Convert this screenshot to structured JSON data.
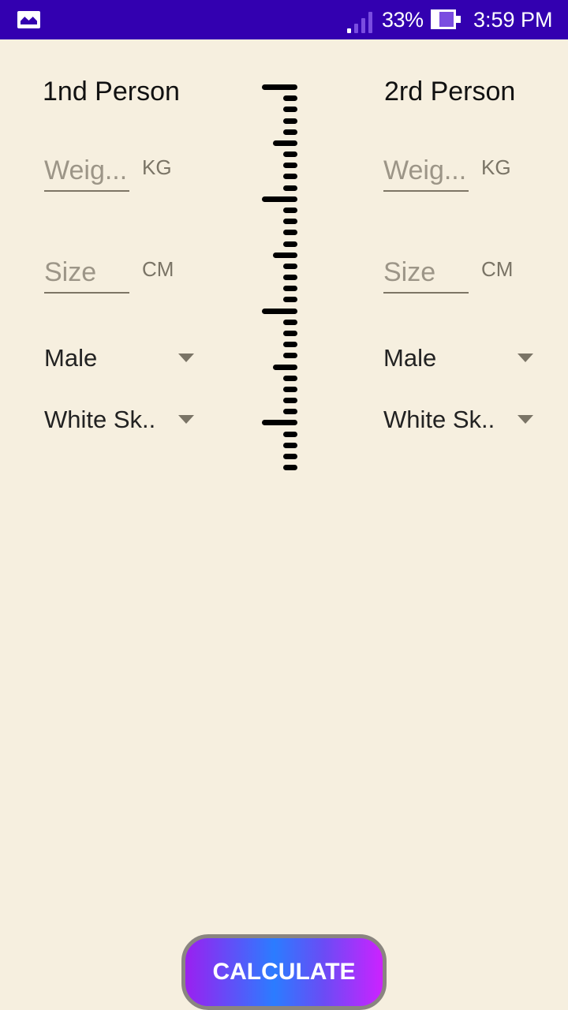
{
  "status_bar": {
    "left_icon": "gallery-icon",
    "signal_icon": "signal-icon",
    "battery_percent": "33%",
    "battery_icon": "battery-icon",
    "time": "3:59 PM",
    "background_color": "#3300b0"
  },
  "person1": {
    "title": "1nd Person",
    "weight": {
      "placeholder": "Weig...",
      "value": "",
      "unit": "KG"
    },
    "size": {
      "placeholder": "Size",
      "value": "",
      "unit": "CM"
    },
    "gender": {
      "selected": "Male"
    },
    "skin": {
      "selected": "White Sk.."
    }
  },
  "person2": {
    "title": "2rd Person",
    "weight": {
      "placeholder": "Weig...",
      "value": "",
      "unit": "KG"
    },
    "size": {
      "placeholder": "Size",
      "value": "",
      "unit": "CM"
    },
    "gender": {
      "selected": "Male"
    },
    "skin": {
      "selected": "White Sk.."
    }
  },
  "ruler": {
    "icon": "ruler-icon",
    "tick_count": 35
  },
  "calculate_button": {
    "label": "CALCULATE"
  },
  "colors": {
    "background": "#f6efdf",
    "accent_gradient": [
      "#9a20f0",
      "#2b7cff",
      "#cc22ff"
    ]
  }
}
